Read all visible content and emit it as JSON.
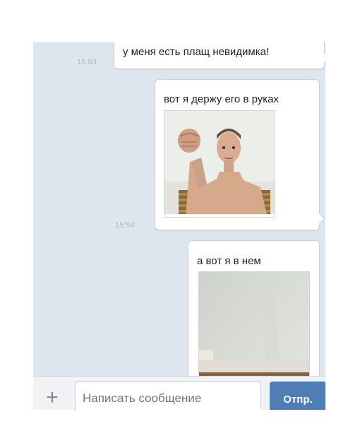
{
  "messages": [
    {
      "text": "у меня есть плащ невидимка!",
      "time": "15:53"
    },
    {
      "text": "вот я держу его в руках",
      "time": "15:54",
      "photo": "man-raising-fist"
    },
    {
      "text": "а вот я в нем",
      "photo": "empty-room-with-couch"
    }
  ],
  "composer": {
    "attach_icon": "plus-icon",
    "placeholder": "Написать сообщение",
    "send_label": "Отпр."
  },
  "colors": {
    "chat_background": "#dde6ef",
    "bubble": "#ffffff",
    "send_button": "#4f7eb5",
    "timestamp": "#aeb8c2"
  }
}
